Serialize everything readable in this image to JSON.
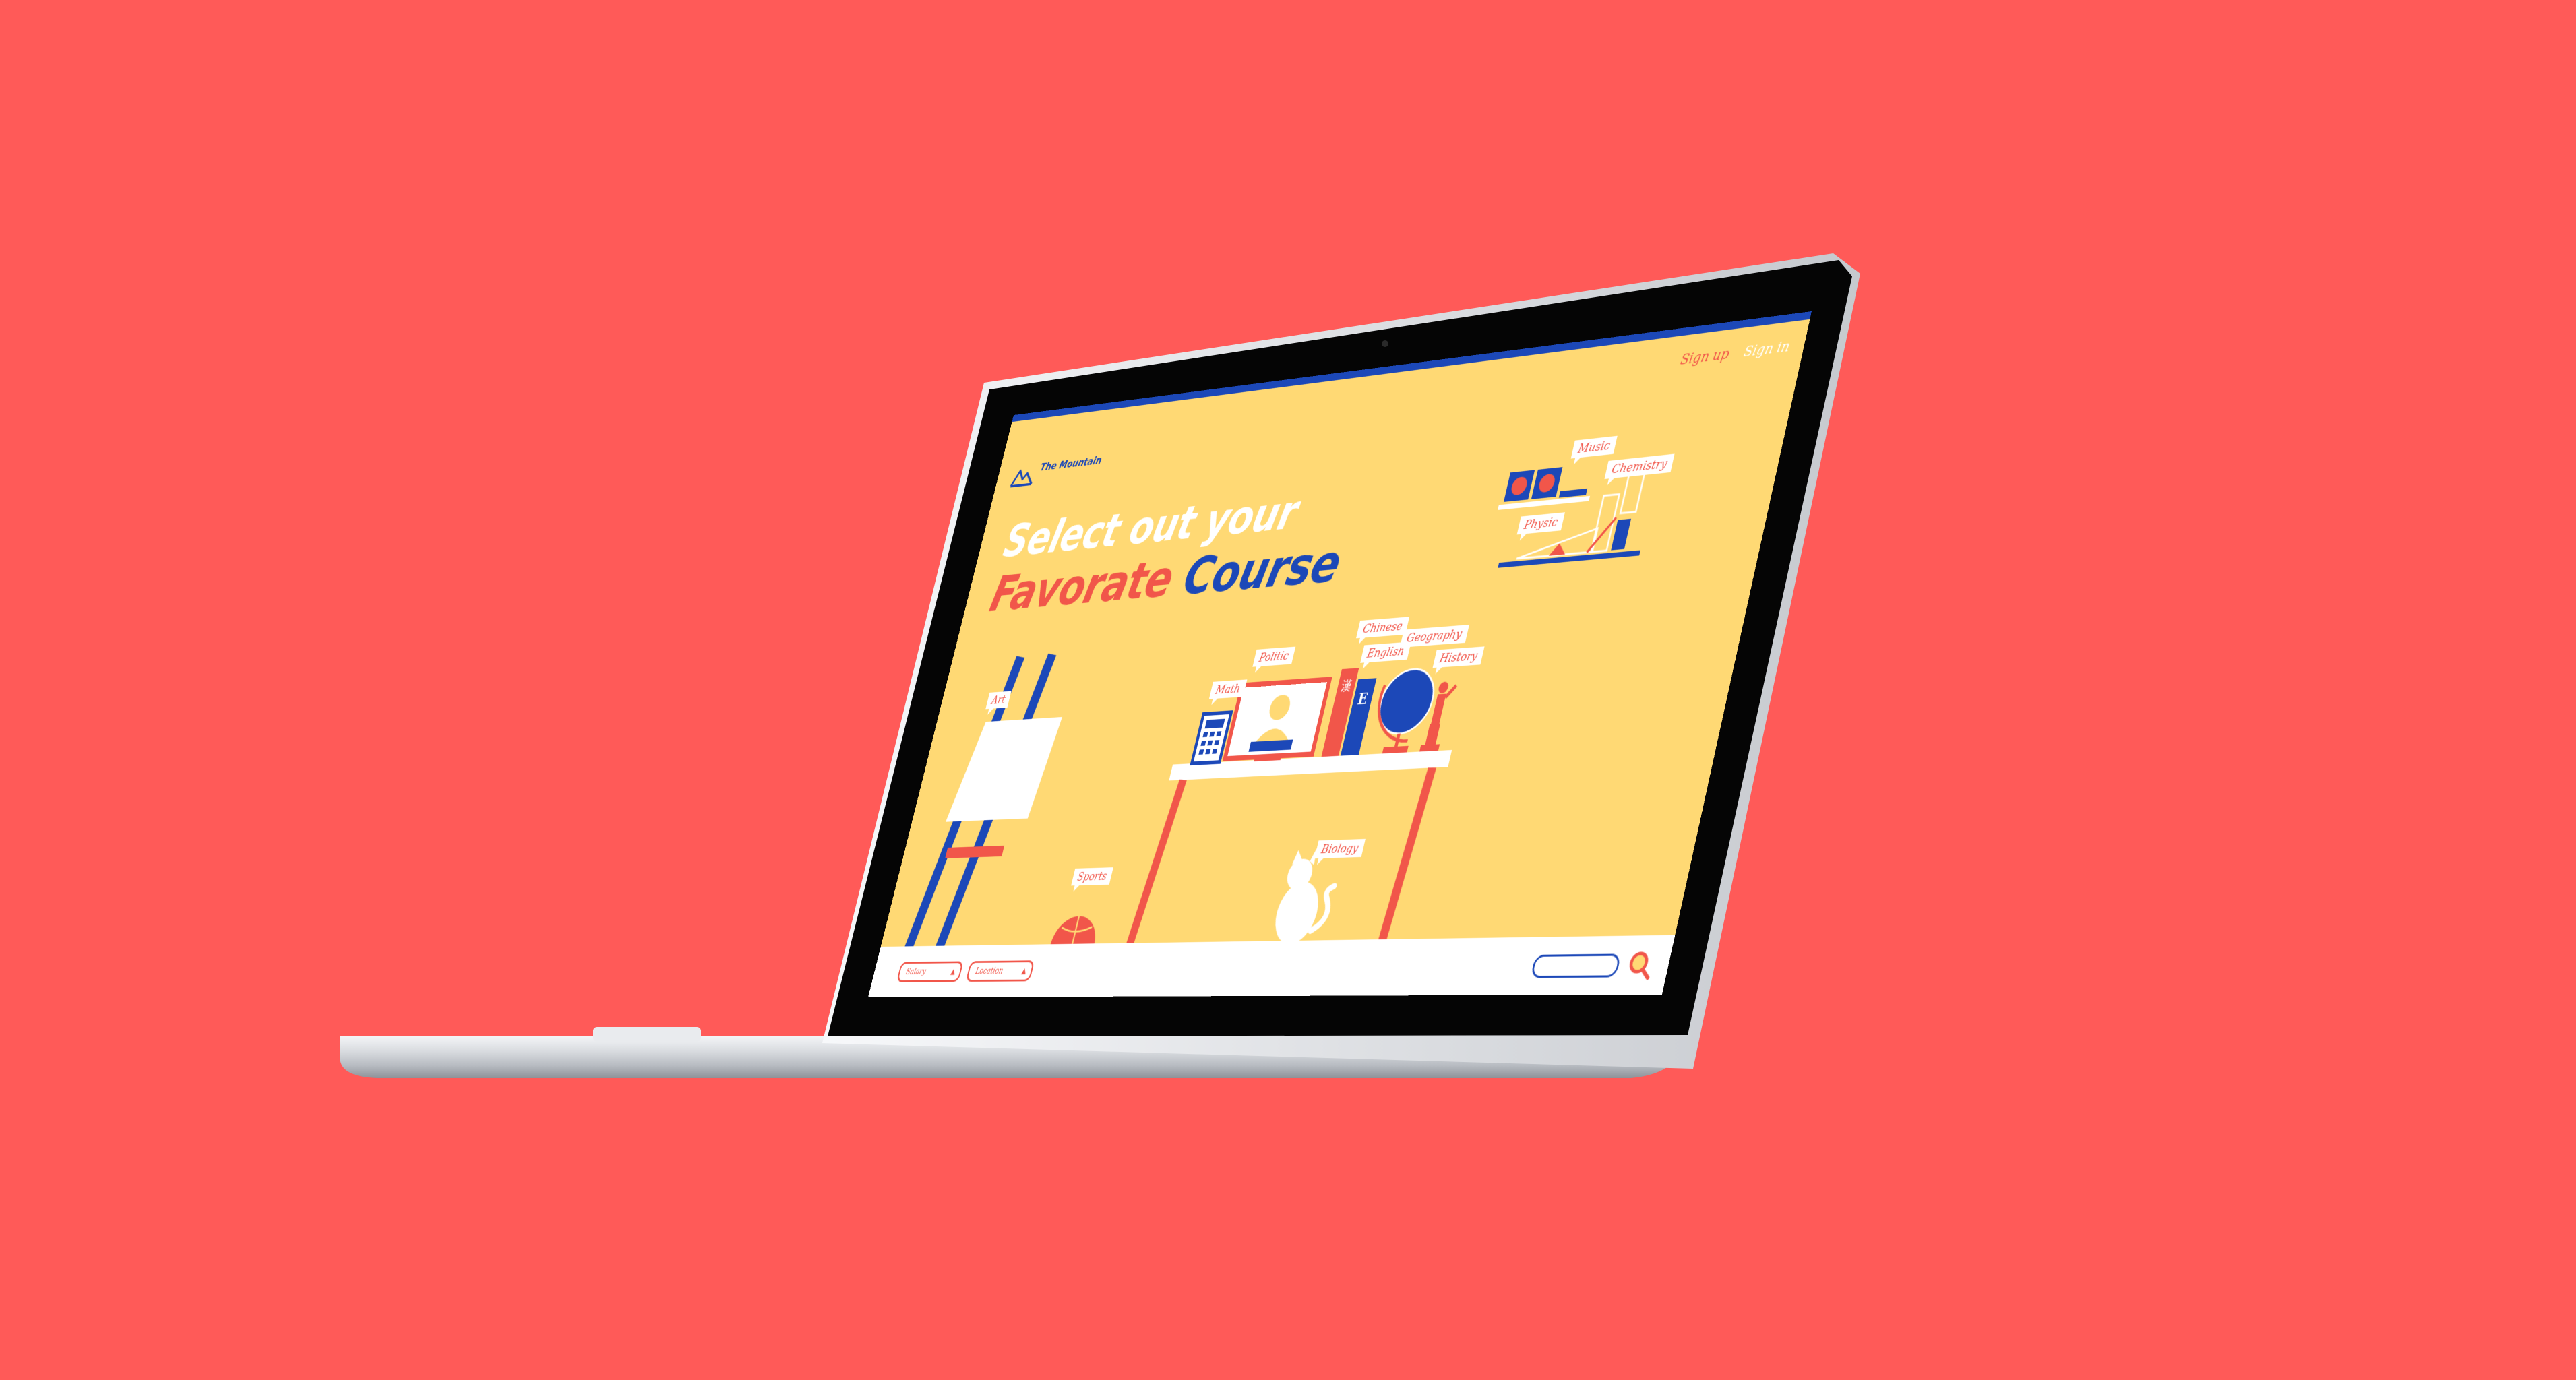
{
  "site": {
    "brand": "The Mountain",
    "nav": {
      "sign_up": "Sign up",
      "sign_in": "Sign in"
    },
    "headline": {
      "line1": "Select out your",
      "line2_part1": "Favorate",
      "line2_part2": "Course"
    }
  },
  "courses": {
    "music": "Music",
    "chemistry": "Chemistry",
    "physic": "Physic",
    "chinese": "Chinese",
    "english": "English",
    "geography": "Geography",
    "history": "History",
    "politic": "Politic",
    "math": "Math",
    "art": "Art",
    "sports": "Sports",
    "biology": "Biology"
  },
  "book_glyphs": {
    "chinese": "漢",
    "english": "E"
  },
  "filters": {
    "salary": {
      "label": "Salary",
      "caret": "▲"
    },
    "location": {
      "label": "Location",
      "caret": "▲"
    }
  },
  "search": {
    "value": ""
  },
  "colors": {
    "background": "#FF5A58",
    "site_bg": "#FFD974",
    "blue": "#1C48B8",
    "coral": "#F1564A",
    "white": "#FFFFFF"
  }
}
